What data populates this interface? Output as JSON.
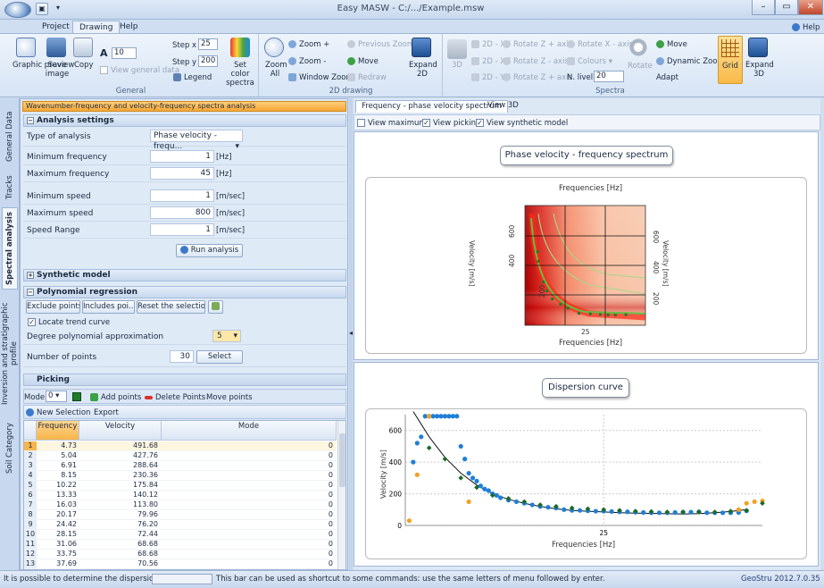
{
  "window": {
    "title": "Easy MASW - C:/.../Example.msw",
    "help": "Help"
  },
  "ribbon_tabs": [
    "Project",
    "Drawing",
    "Help"
  ],
  "ribbon": {
    "general": {
      "label": "General",
      "graphic_preview": "Graphic preview",
      "save_image": "Save image",
      "copy": "Copy",
      "font_size": "10",
      "view_general_data": "View general data",
      "step_x_label": "Step x",
      "step_x": "25",
      "step_y_label": "Step y",
      "step_y": "200",
      "legend": "Legend",
      "set_color": "Set color spectra"
    },
    "drawing2d": {
      "label": "2D drawing",
      "zoom_all": "Zoom All",
      "zoom_plus": "Zoom +",
      "zoom_minus": "Zoom -",
      "window_zoom": "Window Zoom",
      "previous_zoom": "Previous Zoom",
      "move": "Move",
      "redraw": "Redraw",
      "expand2d": "Expand 2D"
    },
    "spectra": {
      "label": "Spectra",
      "b3d": "3D",
      "xy": "2D - XY",
      "xz": "2D - XZ",
      "yz": "2D - YZ",
      "rot_z": "Rotate Z + axis",
      "rot_z2": "Rotate Z - axis",
      "rot_x": "Rotate Z + axis",
      "rot_xa": "Rotate X - axis",
      "colours": "Colours",
      "rotate": "Rotate",
      "n_livelli_label": "N. livelli",
      "n_livelli": "20",
      "move": "Move",
      "dynamic_zoom": "Dynamic Zoom",
      "adapt": "Adapt",
      "grid": "Grid",
      "expand3d": "Expand 3D"
    }
  },
  "side_tabs": [
    "General Data",
    "Tracks",
    "Spectral analysis",
    "Inversion and stratigraphic profile",
    "Soil Category"
  ],
  "panel": {
    "header": "Wavenumber-frequency and velocity-frequency spectra analysis",
    "analysis_settings": "Analysis settings",
    "type_label": "Type of analysis",
    "type_value": "Phase velocity - frequ...",
    "rows": [
      {
        "label": "Minimum frequency",
        "value": "1",
        "unit": "[Hz]"
      },
      {
        "label": "Maximum frequency",
        "value": "45",
        "unit": "[Hz]"
      },
      {
        "label": "Minimum speed",
        "value": "1",
        "unit": "[m/sec]"
      },
      {
        "label": "Maximum speed",
        "value": "800",
        "unit": "[m/sec]"
      },
      {
        "label": "Speed Range",
        "value": "1",
        "unit": "[m/sec]"
      }
    ],
    "run_analysis": "Run analysis",
    "synthetic_model": "Synthetic model",
    "polynomial_regression": "Polynomial regression",
    "exclude_points": "Exclude points",
    "includes_points": "Includes poi...",
    "reset_selection": "Reset the selection",
    "locate_trend": "Locate trend curve",
    "degree_label": "Degree polynomial approximation",
    "degree_value": "5",
    "npoints_label": "Number of points",
    "npoints_value": "30",
    "select": "Select",
    "picking": "Picking",
    "mode_label": "Mode",
    "mode_value": "0",
    "add_points": "Add points",
    "delete_points": "Delete Points",
    "move_points": "Move points",
    "new_selection": "New Selection",
    "export": "Export"
  },
  "table": {
    "columns": [
      "Frequency",
      "Velocity",
      "Mode"
    ],
    "rows": [
      [
        "1",
        "4.73",
        "491.68",
        "0"
      ],
      [
        "2",
        "5.04",
        "427.76",
        "0"
      ],
      [
        "3",
        "6.91",
        "288.64",
        "0"
      ],
      [
        "4",
        "8.15",
        "230.36",
        "0"
      ],
      [
        "5",
        "10.22",
        "175.84",
        "0"
      ],
      [
        "6",
        "13.33",
        "140.12",
        "0"
      ],
      [
        "7",
        "16.03",
        "113.80",
        "0"
      ],
      [
        "8",
        "20.17",
        "79.96",
        "0"
      ],
      [
        "9",
        "24.42",
        "76.20",
        "0"
      ],
      [
        "10",
        "28.15",
        "72.44",
        "0"
      ],
      [
        "11",
        "31.06",
        "68.68",
        "0"
      ],
      [
        "12",
        "33.75",
        "68.68",
        "0"
      ],
      [
        "13",
        "37.69",
        "70.56",
        "0"
      ]
    ]
  },
  "content_tabs": [
    "Frequency - phase velocity spectrum",
    "View 3D"
  ],
  "view_options": [
    "View maximums",
    "View picking",
    "View synthetic model"
  ],
  "spectrum_chart": {
    "title": "Phase velocity - frequency spectrum",
    "xlabel": "Frequencies [Hz]",
    "ylabel": "Velocity [m/s]",
    "y_ticks": [
      "200",
      "400",
      "600"
    ],
    "x_tick": "25"
  },
  "chart_data": {
    "type": "scatter",
    "title": "Dispersion curve",
    "xlabel": "Frequencies [Hz]",
    "ylabel": "Velocity [m/s]",
    "xlim": [
      0,
      45
    ],
    "ylim": [
      0,
      700
    ],
    "x_ticks": [
      25
    ],
    "y_ticks": [
      0,
      200,
      400,
      600
    ],
    "series": [
      {
        "color": "#1e7fd8",
        "x": [
          1.0,
          1.5,
          2.0,
          2.5,
          3,
          3.5,
          4,
          4.5,
          5,
          5.5,
          6,
          6.5,
          7,
          7.5,
          8,
          8.5,
          9,
          9.5,
          10,
          10.5,
          11,
          11.5,
          12,
          13,
          14,
          15,
          16,
          17,
          18,
          19,
          20,
          21,
          22,
          23,
          24,
          25,
          26,
          27,
          28,
          29,
          30,
          31,
          32,
          33,
          34,
          35,
          36,
          37,
          38,
          39,
          40,
          41,
          42,
          43
        ],
        "y": [
          400,
          520,
          560,
          690,
          690,
          690,
          690,
          690,
          690,
          690,
          690,
          690,
          500,
          420,
          330,
          300,
          280,
          250,
          230,
          220,
          200,
          190,
          175,
          160,
          150,
          140,
          130,
          120,
          115,
          110,
          100,
          95,
          95,
          92,
          90,
          90,
          88,
          86,
          86,
          84,
          82,
          80,
          80,
          80,
          82,
          84,
          84,
          86,
          80,
          80,
          80,
          80,
          82,
          92
        ]
      },
      {
        "color": "#f2a126",
        "x": [
          0.5,
          1.5,
          3,
          8,
          42,
          43,
          44,
          45
        ],
        "y": [
          30,
          320,
          690,
          150,
          100,
          140,
          150,
          155
        ]
      },
      {
        "color": "#1a6a26",
        "x": [
          3,
          5,
          7,
          9,
          11,
          13,
          15,
          17,
          19,
          21,
          23,
          25,
          27,
          29,
          31,
          33,
          35,
          37,
          39,
          41,
          43,
          45
        ],
        "y": [
          490,
          420,
          300,
          240,
          190,
          170,
          150,
          130,
          120,
          110,
          105,
          100,
          95,
          90,
          88,
          85,
          85,
          85,
          85,
          90,
          95,
          140
        ]
      }
    ],
    "trend": {
      "x": [
        1,
        3,
        5,
        7,
        9,
        11,
        13,
        15,
        17,
        19,
        21,
        23,
        25,
        27,
        29,
        31,
        33,
        35,
        37,
        39,
        41,
        43
      ],
      "y": [
        720,
        560,
        430,
        330,
        255,
        200,
        165,
        140,
        120,
        105,
        95,
        90,
        85,
        80,
        78,
        76,
        74,
        72,
        75,
        80,
        88,
        100
      ]
    }
  },
  "status": {
    "left": "It is possible to determine the dispersion curve.",
    "middle": "This bar can be used as shortcut to some commands: use the same letters of menu followed by enter.",
    "right": "GeoStru 2012.7.0.35"
  }
}
